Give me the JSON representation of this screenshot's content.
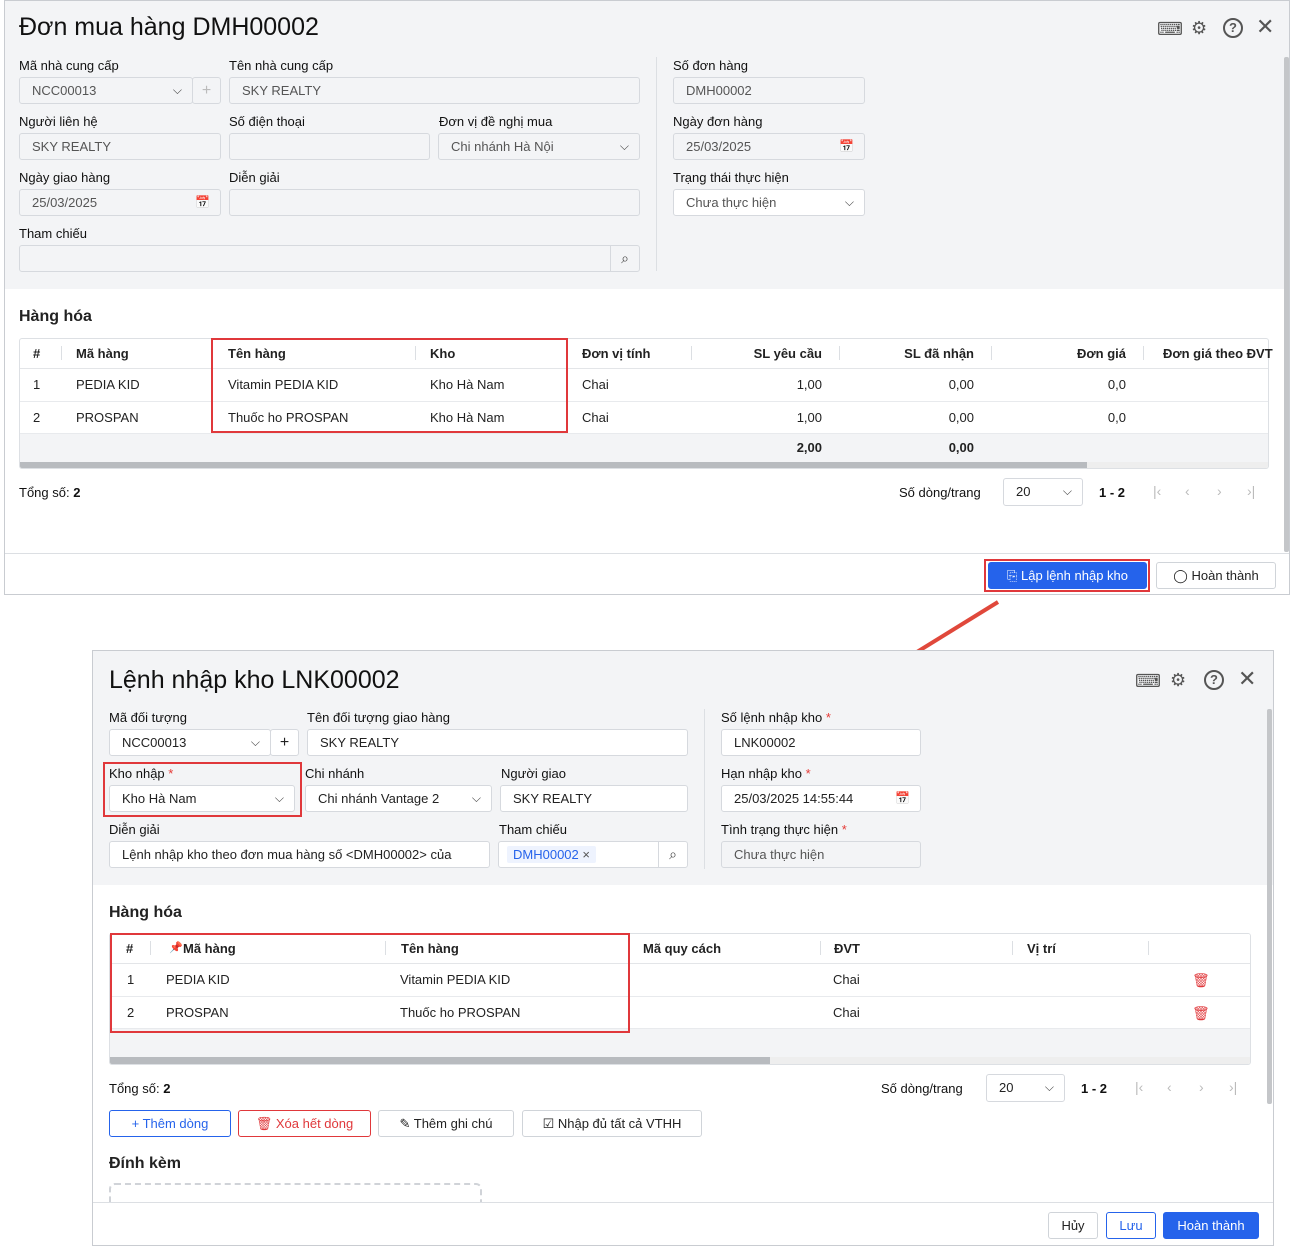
{
  "po": {
    "title": "Đơn mua hàng DMH00002",
    "fields": {
      "supplier_code_label": "Mã nhà cung cấp",
      "supplier_code": "NCC00013",
      "supplier_name_label": "Tên nhà cung cấp",
      "supplier_name": "SKY REALTY",
      "order_no_label": "Số đơn hàng",
      "order_no": "DMH00002",
      "contact_label": "Người liên hệ",
      "contact": "SKY REALTY",
      "phone_label": "Số điện thoại",
      "phone": "",
      "dept_label": "Đơn vị đề nghị mua",
      "dept": "Chi nhánh Hà Nội",
      "order_date_label": "Ngày đơn hàng",
      "order_date": "25/03/2025",
      "delivery_date_label": "Ngày giao hàng",
      "delivery_date": "25/03/2025",
      "desc_label": "Diễn giải",
      "desc": "",
      "status_label": "Trạng thái thực hiện",
      "status": "Chưa thực hiện",
      "ref_label": "Tham chiếu",
      "ref": ""
    },
    "goods_heading": "Hàng hóa",
    "columns": [
      "#",
      "Mã hàng",
      "Tên hàng",
      "Kho",
      "Đơn vị tính",
      "SL yêu cầu",
      "SL đã nhận",
      "Đơn giá",
      "Đơn giá theo ĐVT"
    ],
    "rows": [
      [
        "1",
        "PEDIA KID",
        "Vitamin PEDIA KID",
        "Kho Hà Nam",
        "Chai",
        "1,00",
        "0,00",
        "0,0",
        ""
      ],
      [
        "2",
        "PROSPAN",
        "Thuốc ho PROSPAN",
        "Kho Hà Nam",
        "Chai",
        "1,00",
        "0,00",
        "0,0",
        ""
      ]
    ],
    "totals": {
      "req": "2,00",
      "recv": "0,00"
    },
    "total_label": "Tổng số:",
    "total": "2",
    "page_size_label": "Số dòng/trang",
    "page_size": "20",
    "range": "1 - 2",
    "create_receipt_btn": "Lập lệnh nhập kho",
    "complete_btn": "Hoàn thành"
  },
  "gr": {
    "title": "Lệnh nhập kho LNK00002",
    "fields": {
      "object_label": "Mã đối tượng",
      "object": "NCC00013",
      "object_name_label": "Tên đối tượng giao hàng",
      "object_name": "SKY REALTY",
      "no_label": "Số lệnh nhập kho",
      "no": "LNK00002",
      "warehouse_label": "Kho nhập",
      "warehouse": "Kho Hà Nam",
      "branch_label": "Chi nhánh",
      "branch": "Chi nhánh Vantage 2",
      "deliverer_label": "Người giao",
      "deliverer": "SKY REALTY",
      "deadline_label": "Hạn nhập kho",
      "deadline": "25/03/2025 14:55:44",
      "desc_label": "Diễn giải",
      "desc": "Lệnh nhập kho theo đơn mua hàng số <DMH00002> của",
      "ref_label": "Tham chiếu",
      "ref_tag": "DMH00002",
      "status_label": "Tình trạng thực hiện",
      "status": "Chưa thực hiện"
    },
    "goods_heading": "Hàng hóa",
    "columns": [
      "#",
      "Mã hàng",
      "Tên hàng",
      "Mã quy cách",
      "ĐVT",
      "Vị trí"
    ],
    "rows": [
      [
        "1",
        "PEDIA KID",
        "Vitamin PEDIA KID",
        "",
        "Chai",
        ""
      ],
      [
        "2",
        "PROSPAN",
        "Thuốc ho PROSPAN",
        "",
        "Chai",
        ""
      ]
    ],
    "total_label": "Tổng số:",
    "total": "2",
    "page_size_label": "Số dòng/trang",
    "page_size": "20",
    "range": "1 - 2",
    "actions": {
      "add_row": "Thêm dòng",
      "delete_all": "Xóa hết dòng",
      "add_note": "Thêm ghi chú",
      "fill_all": "Nhập đủ tất cả VTHH"
    },
    "attach_heading": "Đính kèm",
    "cancel": "Hủy",
    "save": "Lưu",
    "complete": "Hoàn thành"
  },
  "colors": {
    "primary": "#2563eb",
    "highlight": "#e0383b"
  }
}
